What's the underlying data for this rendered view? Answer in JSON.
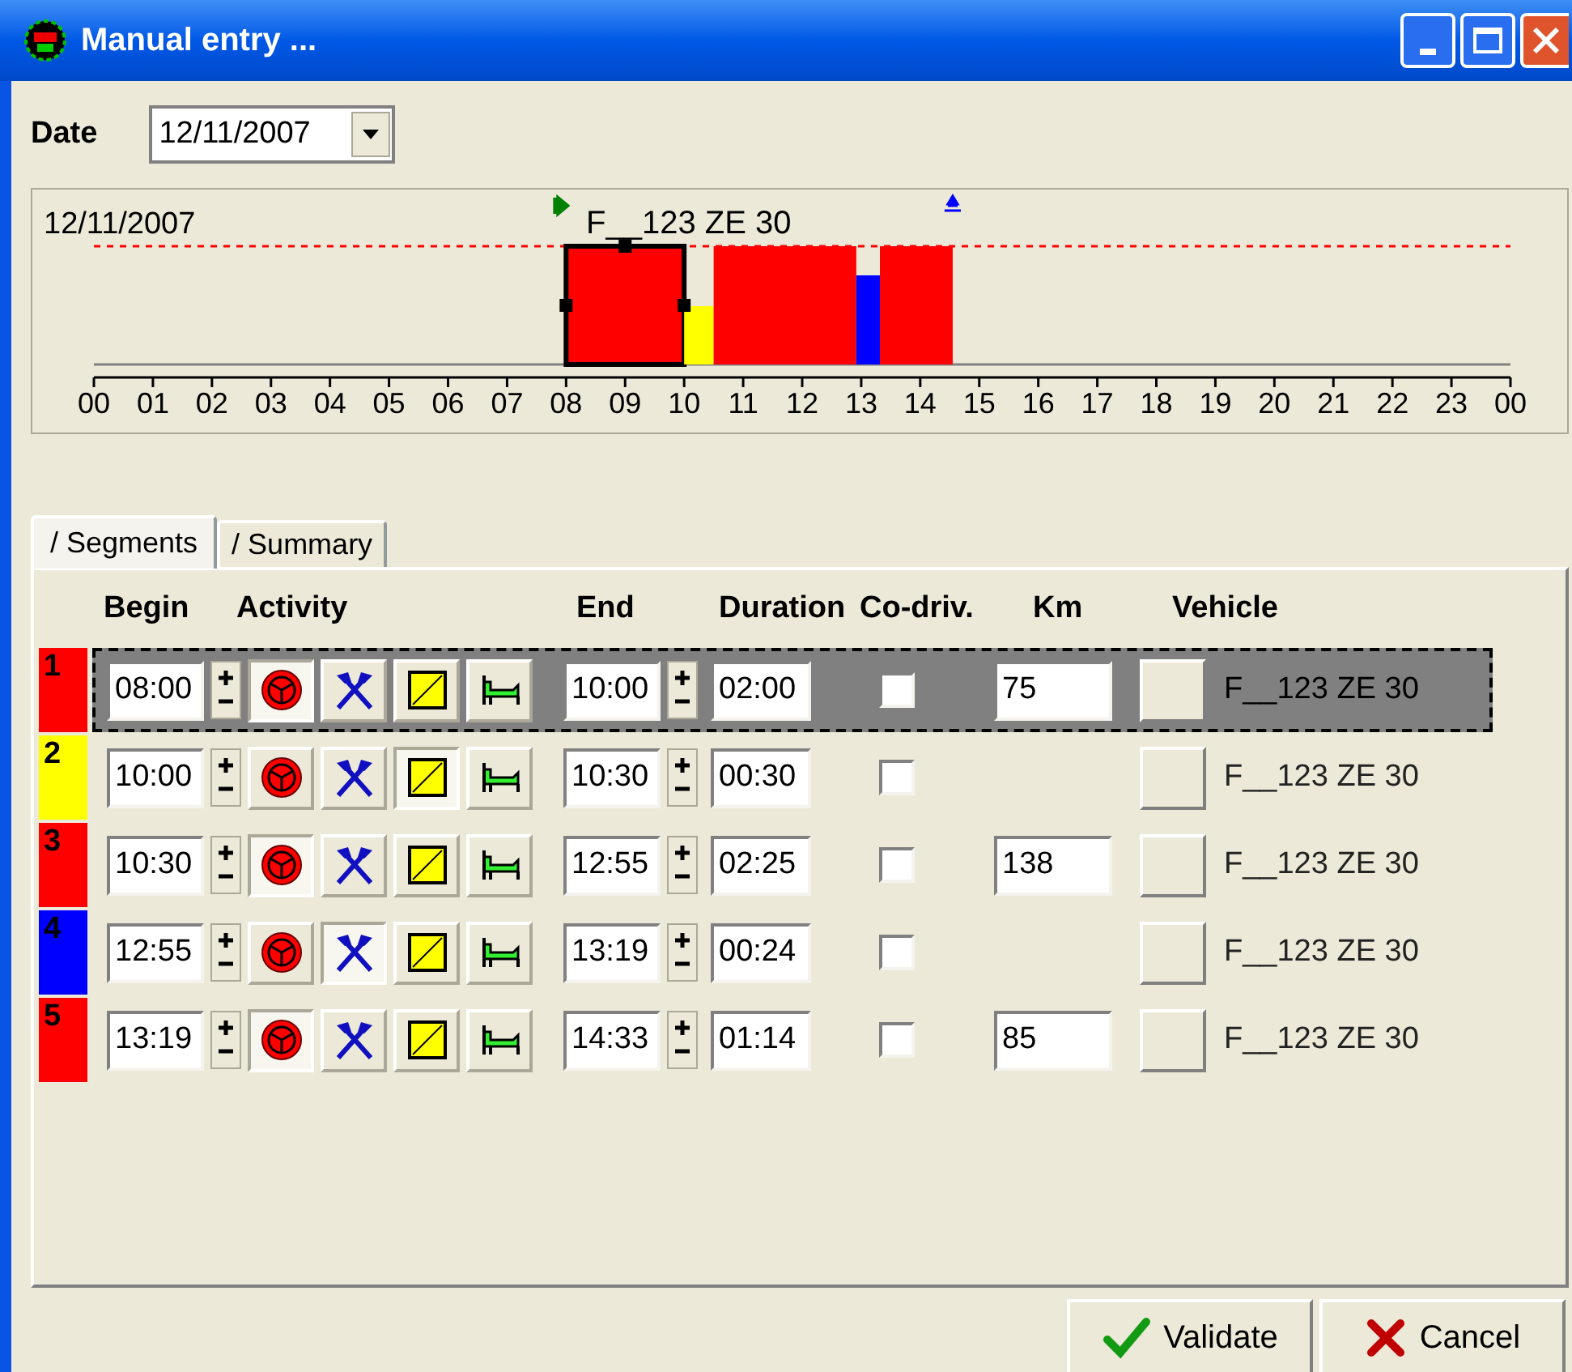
{
  "window": {
    "title": "Manual entry ..."
  },
  "date": {
    "label": "Date",
    "value": "12/11/2007"
  },
  "timeline": {
    "date": "12/11/2007",
    "vehicle": "F__123 ZE 30",
    "hours": [
      "00",
      "01",
      "02",
      "03",
      "04",
      "05",
      "06",
      "07",
      "08",
      "09",
      "10",
      "11",
      "12",
      "13",
      "14",
      "15",
      "16",
      "17",
      "18",
      "19",
      "20",
      "21",
      "22",
      "23",
      "00"
    ]
  },
  "tabs": [
    {
      "label": "/ Segments",
      "selected": true
    },
    {
      "label": "/ Summary",
      "selected": false
    }
  ],
  "columns": [
    "Begin",
    "Activity",
    "End",
    "Duration",
    "Co-driv.",
    "Km",
    "Vehicle"
  ],
  "segments": [
    {
      "number": "1",
      "color": "#ff0000",
      "selected": true,
      "begin": "08:00",
      "activities": [
        {
          "kind": "driving",
          "selected": true
        },
        {
          "kind": "work",
          "selected": false
        },
        {
          "kind": "availability",
          "selected": false
        },
        {
          "kind": "rest",
          "selected": false
        }
      ],
      "end": "10:00",
      "duration": "02:00",
      "co_driver": false,
      "km": "75",
      "vehicle": "F__123 ZE 30"
    },
    {
      "number": "2",
      "color": "#ffff00",
      "selected": false,
      "begin": "10:00",
      "activities": [
        {
          "kind": "driving",
          "selected": false
        },
        {
          "kind": "work",
          "selected": false
        },
        {
          "kind": "availability",
          "selected": true
        },
        {
          "kind": "rest",
          "selected": false
        }
      ],
      "end": "10:30",
      "duration": "00:30",
      "co_driver": false,
      "vehicle": "F__123 ZE 30"
    },
    {
      "number": "3",
      "color": "#ff0000",
      "selected": false,
      "begin": "10:30",
      "activities": [
        {
          "kind": "driving",
          "selected": true
        },
        {
          "kind": "work",
          "selected": false
        },
        {
          "kind": "availability",
          "selected": false
        },
        {
          "kind": "rest",
          "selected": false
        }
      ],
      "end": "12:55",
      "duration": "02:25",
      "co_driver": false,
      "km": "138",
      "vehicle": "F__123 ZE 30"
    },
    {
      "number": "4",
      "color": "#0000ff",
      "selected": false,
      "begin": "12:55",
      "activities": [
        {
          "kind": "driving",
          "selected": false
        },
        {
          "kind": "work",
          "selected": true
        },
        {
          "kind": "availability",
          "selected": false
        },
        {
          "kind": "rest",
          "selected": false
        }
      ],
      "end": "13:19",
      "duration": "00:24",
      "co_driver": false,
      "vehicle": "F__123 ZE 30"
    },
    {
      "number": "5",
      "color": "#ff0000",
      "selected": false,
      "begin": "13:19",
      "activities": [
        {
          "kind": "driving",
          "selected": true
        },
        {
          "kind": "work",
          "selected": false
        },
        {
          "kind": "availability",
          "selected": false
        },
        {
          "kind": "rest",
          "selected": false
        }
      ],
      "end": "14:33",
      "duration": "01:14",
      "co_driver": false,
      "km": "85",
      "vehicle": "F__123 ZE 30"
    }
  ],
  "buttons": [
    {
      "label": "Validate",
      "kind": "validate"
    },
    {
      "label": "Cancel",
      "kind": "cancel"
    }
  ]
}
